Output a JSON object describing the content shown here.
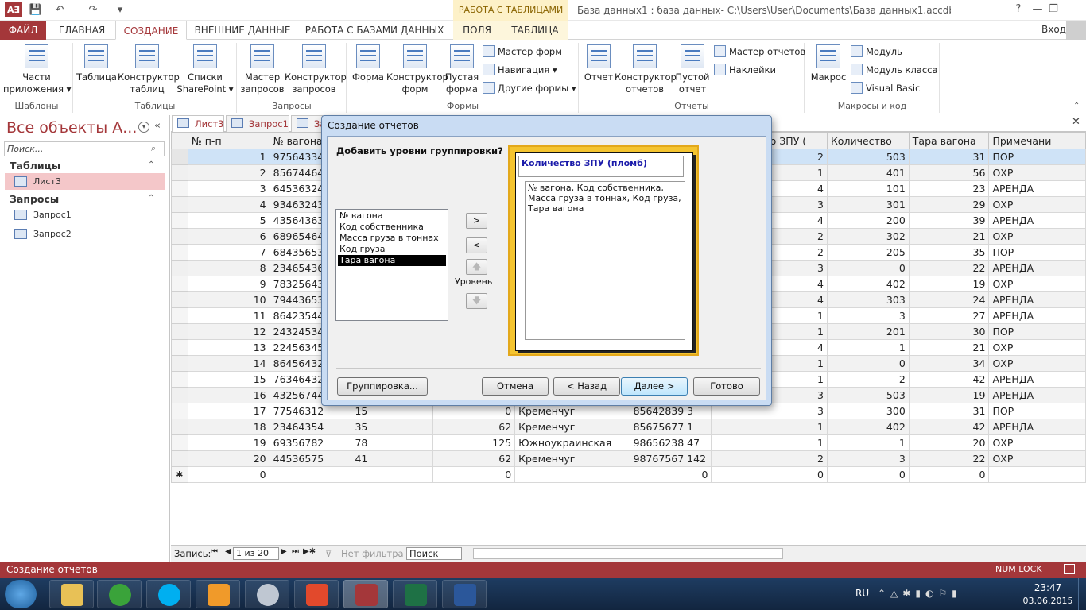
{
  "window": {
    "app_icon": "A∃",
    "context_title": "РАБОТА С ТАБЛИЦАМИ",
    "title": "База данных1 : база данных- C:\\Users\\User\\Documents\\База данных1.accdb (Формат файлов...",
    "qa_icons": [
      "save-icon",
      "undo-icon",
      "redo-icon"
    ],
    "win_buttons": [
      "?",
      "—",
      "❐"
    ]
  },
  "ribbon_tabs": {
    "file": "ФАЙЛ",
    "home": "ГЛАВНАЯ",
    "create": "СОЗДАНИЕ",
    "external": "ВНЕШНИЕ ДАННЫЕ",
    "dbtools": "РАБОТА С БАЗАМИ ДАННЫХ",
    "fields": "ПОЛЯ",
    "table": "ТАБЛИЦА",
    "signin": "Вход"
  },
  "ribbon": {
    "templates": {
      "btn1": "Части",
      "btn2": "приложения ▾",
      "label": "Шаблоны"
    },
    "tables": {
      "t1": "Таблица",
      "t2a": "Конструктор",
      "t2b": "таблиц",
      "t3a": "Списки",
      "t3b": "SharePoint ▾",
      "label": "Таблицы"
    },
    "queries": {
      "q1a": "Мастер",
      "q1b": "запросов",
      "q2a": "Конструктор",
      "q2b": "запросов",
      "label": "Запросы"
    },
    "forms": {
      "f1": "Форма",
      "f2a": "Конструктор",
      "f2b": "форм",
      "f3a": "Пустая",
      "f3b": "форма",
      "s1": "Мастер форм",
      "s2": "Навигация ▾",
      "s3": "Другие формы ▾",
      "label": "Формы"
    },
    "reports": {
      "r1": "Отчет",
      "r2a": "Конструктор",
      "r2b": "отчетов",
      "r3a": "Пустой",
      "r3b": "отчет",
      "s1": "Мастер отчетов",
      "s2": "Наклейки",
      "label": "Отчеты"
    },
    "macros": {
      "m1": "Макрос",
      "s1": "Модуль",
      "s2": "Модуль класса",
      "s3": "Visual Basic",
      "label": "Макросы и код"
    }
  },
  "nav": {
    "title": "Все объекты А...",
    "search_placeholder": "Поиск...",
    "section_tables": "Таблицы",
    "tables": [
      "Лист3"
    ],
    "section_queries": "Запросы",
    "queries": [
      "Запрос1",
      "Запрос2"
    ]
  },
  "doc_tabs": [
    "Лист3",
    "Запрос1",
    "За"
  ],
  "grid": {
    "columns": [
      "№ п-п",
      "№ вагона",
      "",
      "",
      "",
      "",
      "Количество ЗПУ (",
      "Количество",
      "Тара вагона",
      "Примечани"
    ],
    "rows": [
      [
        "1",
        "97564334",
        "",
        "",
        "",
        "",
        "2",
        "503",
        "31",
        "ПОР"
      ],
      [
        "2",
        "85674464",
        "",
        "",
        "",
        "",
        "1",
        "401",
        "56",
        "ОХР"
      ],
      [
        "3",
        "64536324",
        "",
        "",
        "",
        "",
        "4",
        "101",
        "23",
        "АРЕНДА"
      ],
      [
        "4",
        "93463243",
        "",
        "",
        "",
        "",
        "3",
        "301",
        "29",
        "ОХР"
      ],
      [
        "5",
        "43564363",
        "",
        "",
        "",
        "",
        "4",
        "200",
        "39",
        "АРЕНДА"
      ],
      [
        "6",
        "68965464",
        "",
        "",
        "",
        "",
        "2",
        "302",
        "21",
        "ОХР"
      ],
      [
        "7",
        "68435653",
        "",
        "",
        "",
        "",
        "2",
        "205",
        "35",
        "ПОР"
      ],
      [
        "8",
        "23465436",
        "",
        "",
        "",
        "",
        "3",
        "0",
        "22",
        "АРЕНДА"
      ],
      [
        "9",
        "78325643",
        "",
        "",
        "",
        "",
        "4",
        "402",
        "19",
        "ОХР"
      ],
      [
        "10",
        "79443653",
        "",
        "",
        "",
        "",
        "4",
        "303",
        "24",
        "АРЕНДА"
      ],
      [
        "11",
        "86423544",
        "",
        "",
        "",
        "",
        "1",
        "3",
        "27",
        "АРЕНДА"
      ],
      [
        "12",
        "24324534",
        "",
        "",
        "",
        "",
        "1",
        "201",
        "30",
        "ПОР"
      ],
      [
        "13",
        "22456345",
        "",
        "",
        "",
        "",
        "4",
        "1",
        "21",
        "ОХР"
      ],
      [
        "14",
        "86456432",
        "",
        "",
        "",
        "",
        "1",
        "0",
        "34",
        "ОХР"
      ],
      [
        "15",
        "76346432",
        "",
        "",
        "",
        "",
        "1",
        "2",
        "42",
        "АРЕНДА"
      ],
      [
        "16",
        "43256744",
        "",
        "",
        "",
        "",
        "3",
        "503",
        "19",
        "АРЕНДА"
      ],
      [
        "17",
        "77546312",
        "15",
        "0",
        "Кременчуг",
        "85642839 3",
        "3",
        "300",
        "31",
        "ПОР"
      ],
      [
        "18",
        "23464354",
        "35",
        "62",
        "Кременчуг",
        "85675677 1",
        "1",
        "402",
        "42",
        "АРЕНДА"
      ],
      [
        "19",
        "69356782",
        "78",
        "125",
        "Южноукраинская",
        "98656238 47",
        "1",
        "1",
        "20",
        "ОХР"
      ],
      [
        "20",
        "44536575",
        "41",
        "62",
        "Кременчуг",
        "98767567 142",
        "2",
        "3",
        "22",
        "ОХР"
      ]
    ],
    "new_row": [
      "0",
      "",
      "",
      "0",
      "",
      "0",
      "0",
      "0",
      "0",
      ""
    ],
    "new_marker": "✱"
  },
  "recnav": {
    "label": "Запись:",
    "position": "1 из 20",
    "filter": "Нет фильтра",
    "search": "Поиск"
  },
  "status": {
    "left": "Создание отчетов",
    "right": "NUM LOCK"
  },
  "dialog": {
    "title": "Создание отчетов",
    "question": "Добавить уровни группировки?",
    "fields": [
      "№ вагона",
      "Код собственника",
      "Масса груза в тоннах",
      "Код груза",
      "Тара вагона"
    ],
    "selected_index": 4,
    "move_right": ">",
    "move_left": "<",
    "level_label": "Уровень",
    "preview_head": "Количество ЗПУ (пломб)",
    "preview_body": "№ вагона, Код собственника, Масса груза в тоннах, Код груза, Тара вагона",
    "btn_grouping": "Группировка...",
    "btn_cancel": "Отмена",
    "btn_back": "< Назад",
    "btn_next": "Далее >",
    "btn_finish": "Готово"
  },
  "taskbar": {
    "lang": "RU",
    "time": "23:47",
    "date": "03.06.2015"
  },
  "colors": {
    "access_red": "#a4373a",
    "selection_blue": "#cfe3f7",
    "preview_yellow": "#f4c430"
  }
}
